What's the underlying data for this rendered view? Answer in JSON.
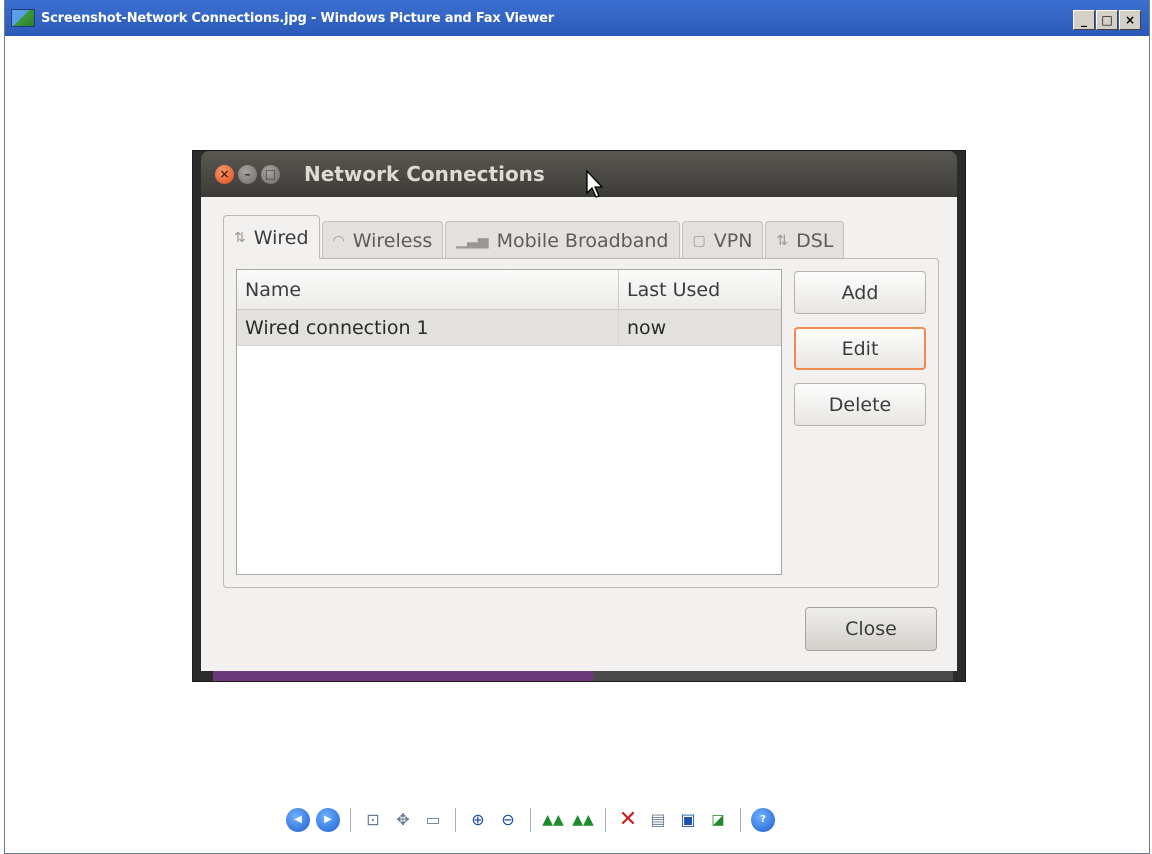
{
  "viewer": {
    "title": "Screenshot-Network Connections.jpg - Windows Picture and Fax Viewer",
    "controls": {
      "minimize": "_",
      "maximize": "□",
      "close": "×"
    }
  },
  "dialog": {
    "title": "Network Connections",
    "tabs": [
      {
        "label": "Wired",
        "icon": "network-wired-icon",
        "active": true
      },
      {
        "label": "Wireless",
        "icon": "wifi-icon",
        "active": false
      },
      {
        "label": "Mobile Broadband",
        "icon": "signal-bars-icon",
        "active": false
      },
      {
        "label": "VPN",
        "icon": "lock-icon",
        "active": false
      },
      {
        "label": "DSL",
        "icon": "network-dsl-icon",
        "active": false
      }
    ],
    "list": {
      "columns": [
        "Name",
        "Last Used"
      ],
      "rows": [
        {
          "name": "Wired connection 1",
          "last_used": "now"
        }
      ]
    },
    "buttons": {
      "add": "Add",
      "edit": "Edit",
      "delete": "Delete",
      "close": "Close"
    }
  },
  "toolbar": {
    "icons": [
      "previous-image-icon",
      "next-image-icon",
      "best-fit-icon",
      "actual-size-icon",
      "slideshow-icon",
      "zoom-in-icon",
      "zoom-out-icon",
      "rotate-clockwise-icon",
      "rotate-counterclockwise-icon",
      "delete-icon",
      "print-icon",
      "save-icon",
      "edit-image-icon",
      "help-icon"
    ]
  },
  "colors": {
    "xp_titlebar": "#2c5ab8",
    "ubuntu_titlebar": "#3c3b37",
    "ubuntu_close": "#df4a16",
    "focus_ring": "#f08a50"
  }
}
